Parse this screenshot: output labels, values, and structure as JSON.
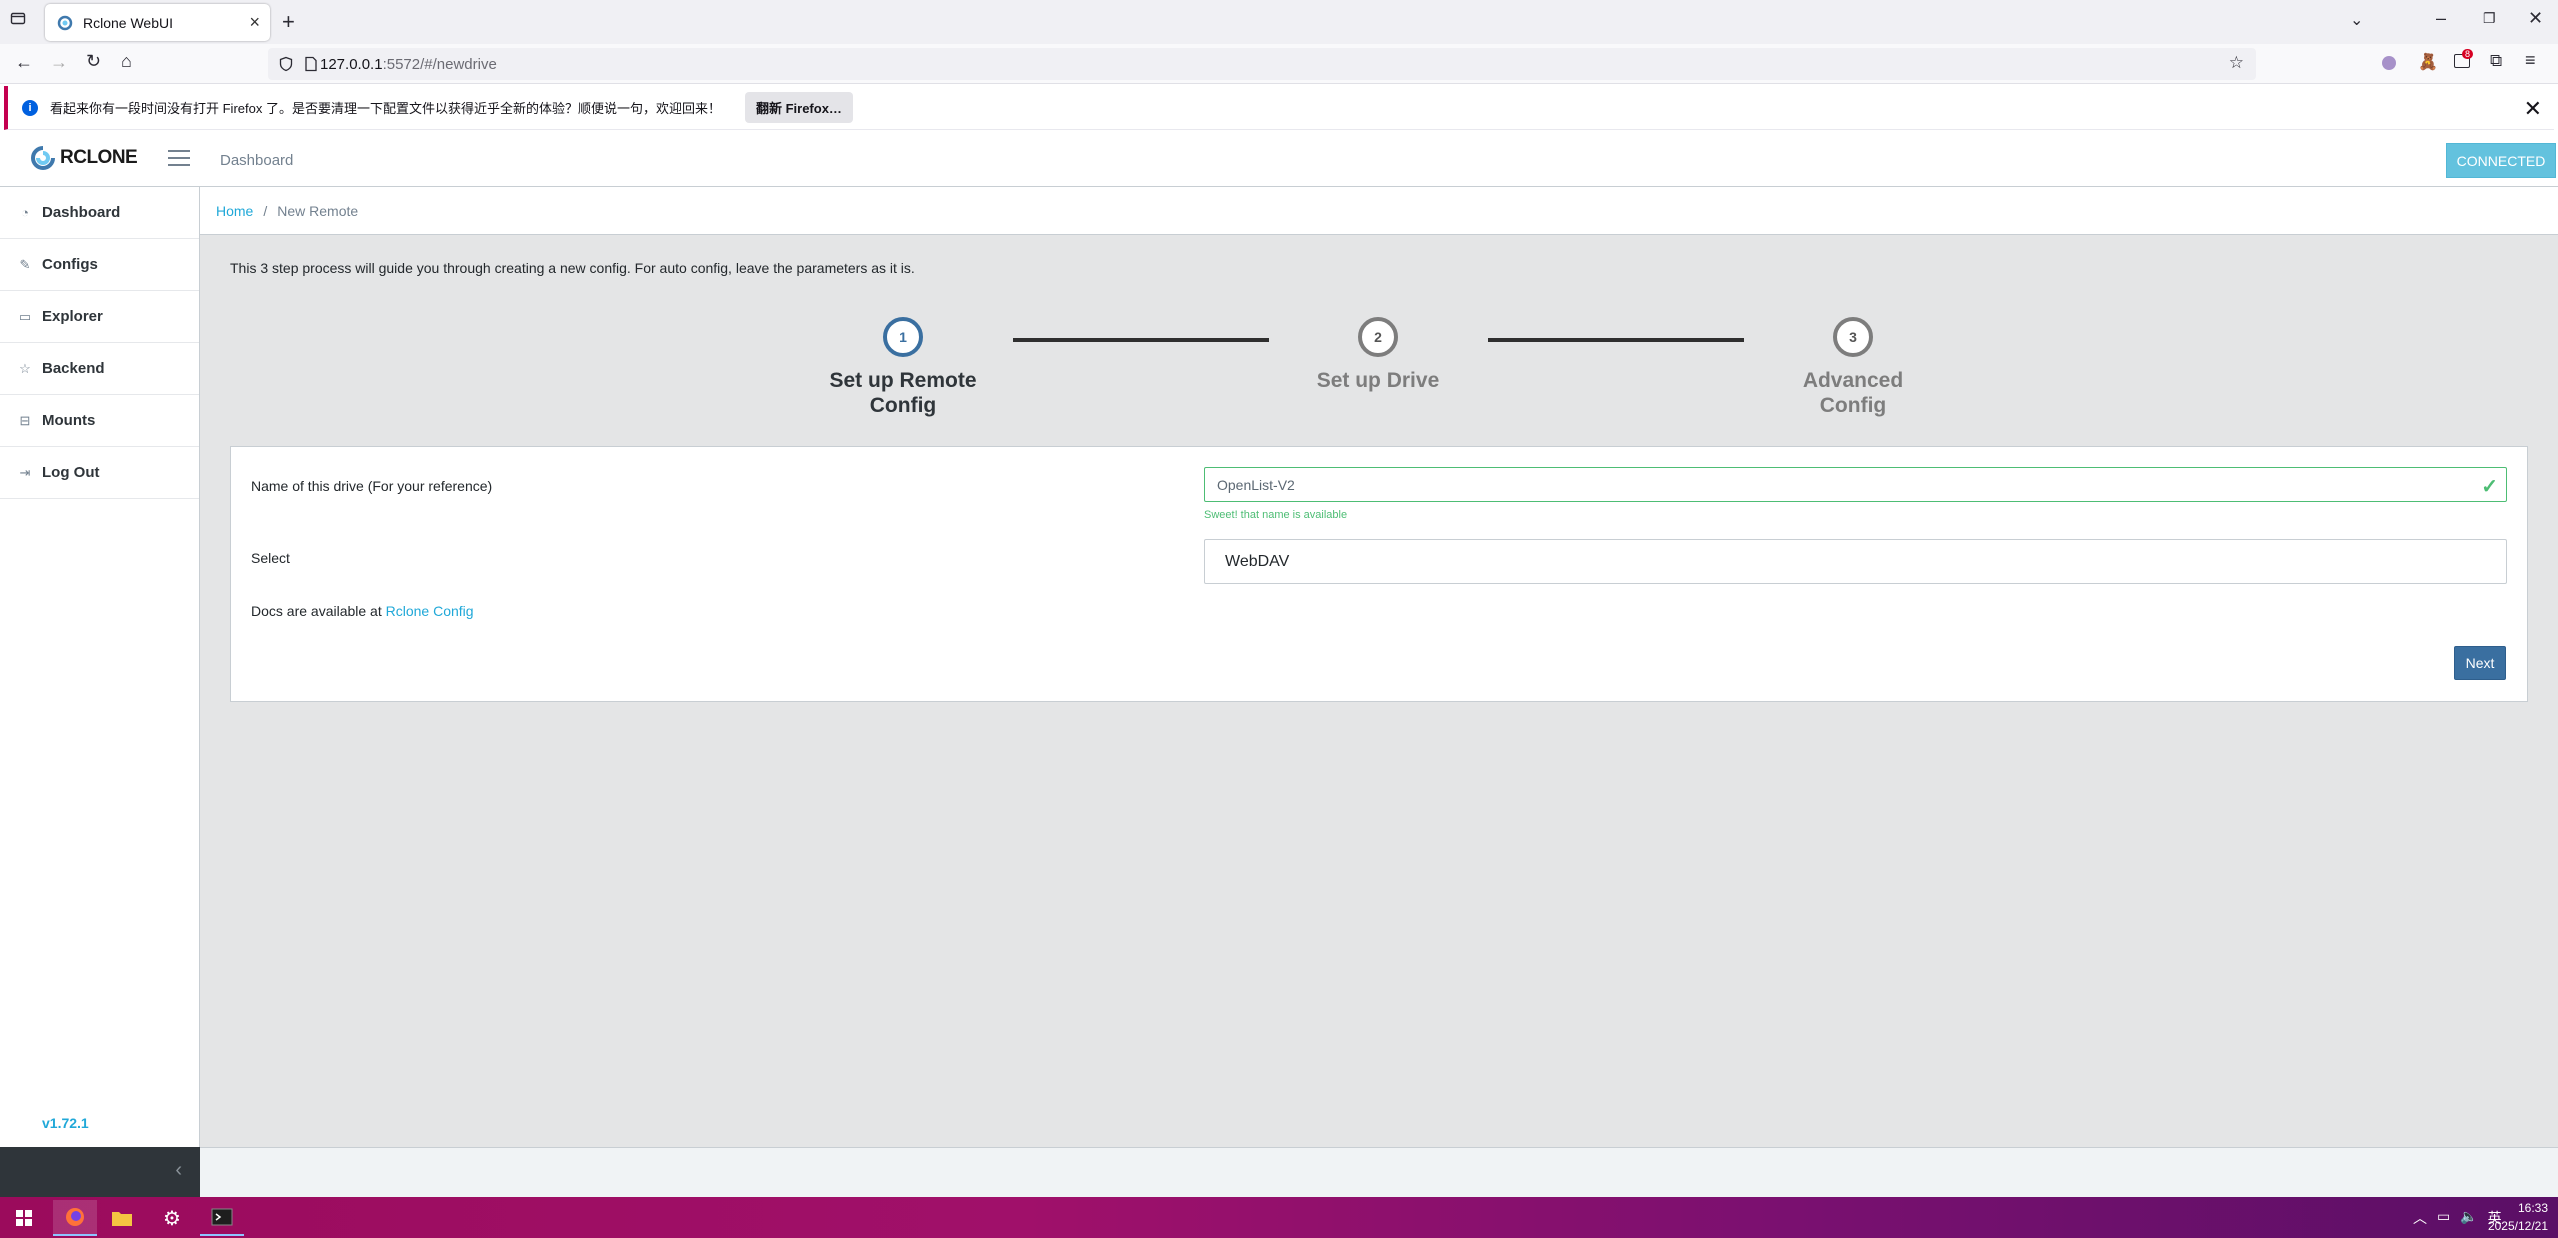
{
  "browser": {
    "tab_title": "Rclone WebUI",
    "url_host": "127.0.0.1",
    "url_path": ":5572/#/newdrive",
    "notification_text": "看起来你有一段时间没有打开 Firefox 了。是否要清理一下配置文件以获得近乎全新的体验？顺便说一句，欢迎回来！",
    "notification_button": "翻新 Firefox…",
    "extension_badge": "8"
  },
  "app": {
    "logo_text": "RCLONE",
    "header_link": "Dashboard",
    "status_badge": "CONNECTED",
    "version": "v1.72.1",
    "sidebar": {
      "items": [
        {
          "label": "Dashboard",
          "icon": "speedometer-icon"
        },
        {
          "label": "Configs",
          "icon": "pencil-square-icon"
        },
        {
          "label": "Explorer",
          "icon": "monitor-icon"
        },
        {
          "label": "Backend",
          "icon": "star-icon"
        },
        {
          "label": "Mounts",
          "icon": "drive-icon"
        },
        {
          "label": "Log Out",
          "icon": "logout-icon"
        }
      ]
    },
    "breadcrumb": {
      "home": "Home",
      "current": "New Remote"
    },
    "intro": "This 3 step process will guide you through creating a new config. For auto config, leave the parameters as it is.",
    "steps": [
      {
        "number": "1",
        "label_line1": "Set up Remote",
        "label_line2": "Config",
        "active": true
      },
      {
        "number": "2",
        "label_line1": "Set up Drive",
        "label_line2": "",
        "active": false
      },
      {
        "number": "3",
        "label_line1": "Advanced",
        "label_line2": "Config",
        "active": false
      }
    ],
    "form": {
      "name_label": "Name of this drive (For your reference)",
      "name_value": "OpenList-V2",
      "name_valid_message": "Sweet! that name is available",
      "select_label": "Select",
      "select_value": "WebDAV",
      "docs_prefix": "Docs are available at ",
      "docs_link": "Rclone Config",
      "next_button": "Next"
    }
  },
  "taskbar": {
    "time": "16:33",
    "date": "2025/12/21",
    "ime": "英"
  },
  "colors": {
    "accent": "#20a8d8",
    "step_active": "#3a6fa0",
    "valid": "#4dbd74",
    "connected": "#63c2de"
  }
}
